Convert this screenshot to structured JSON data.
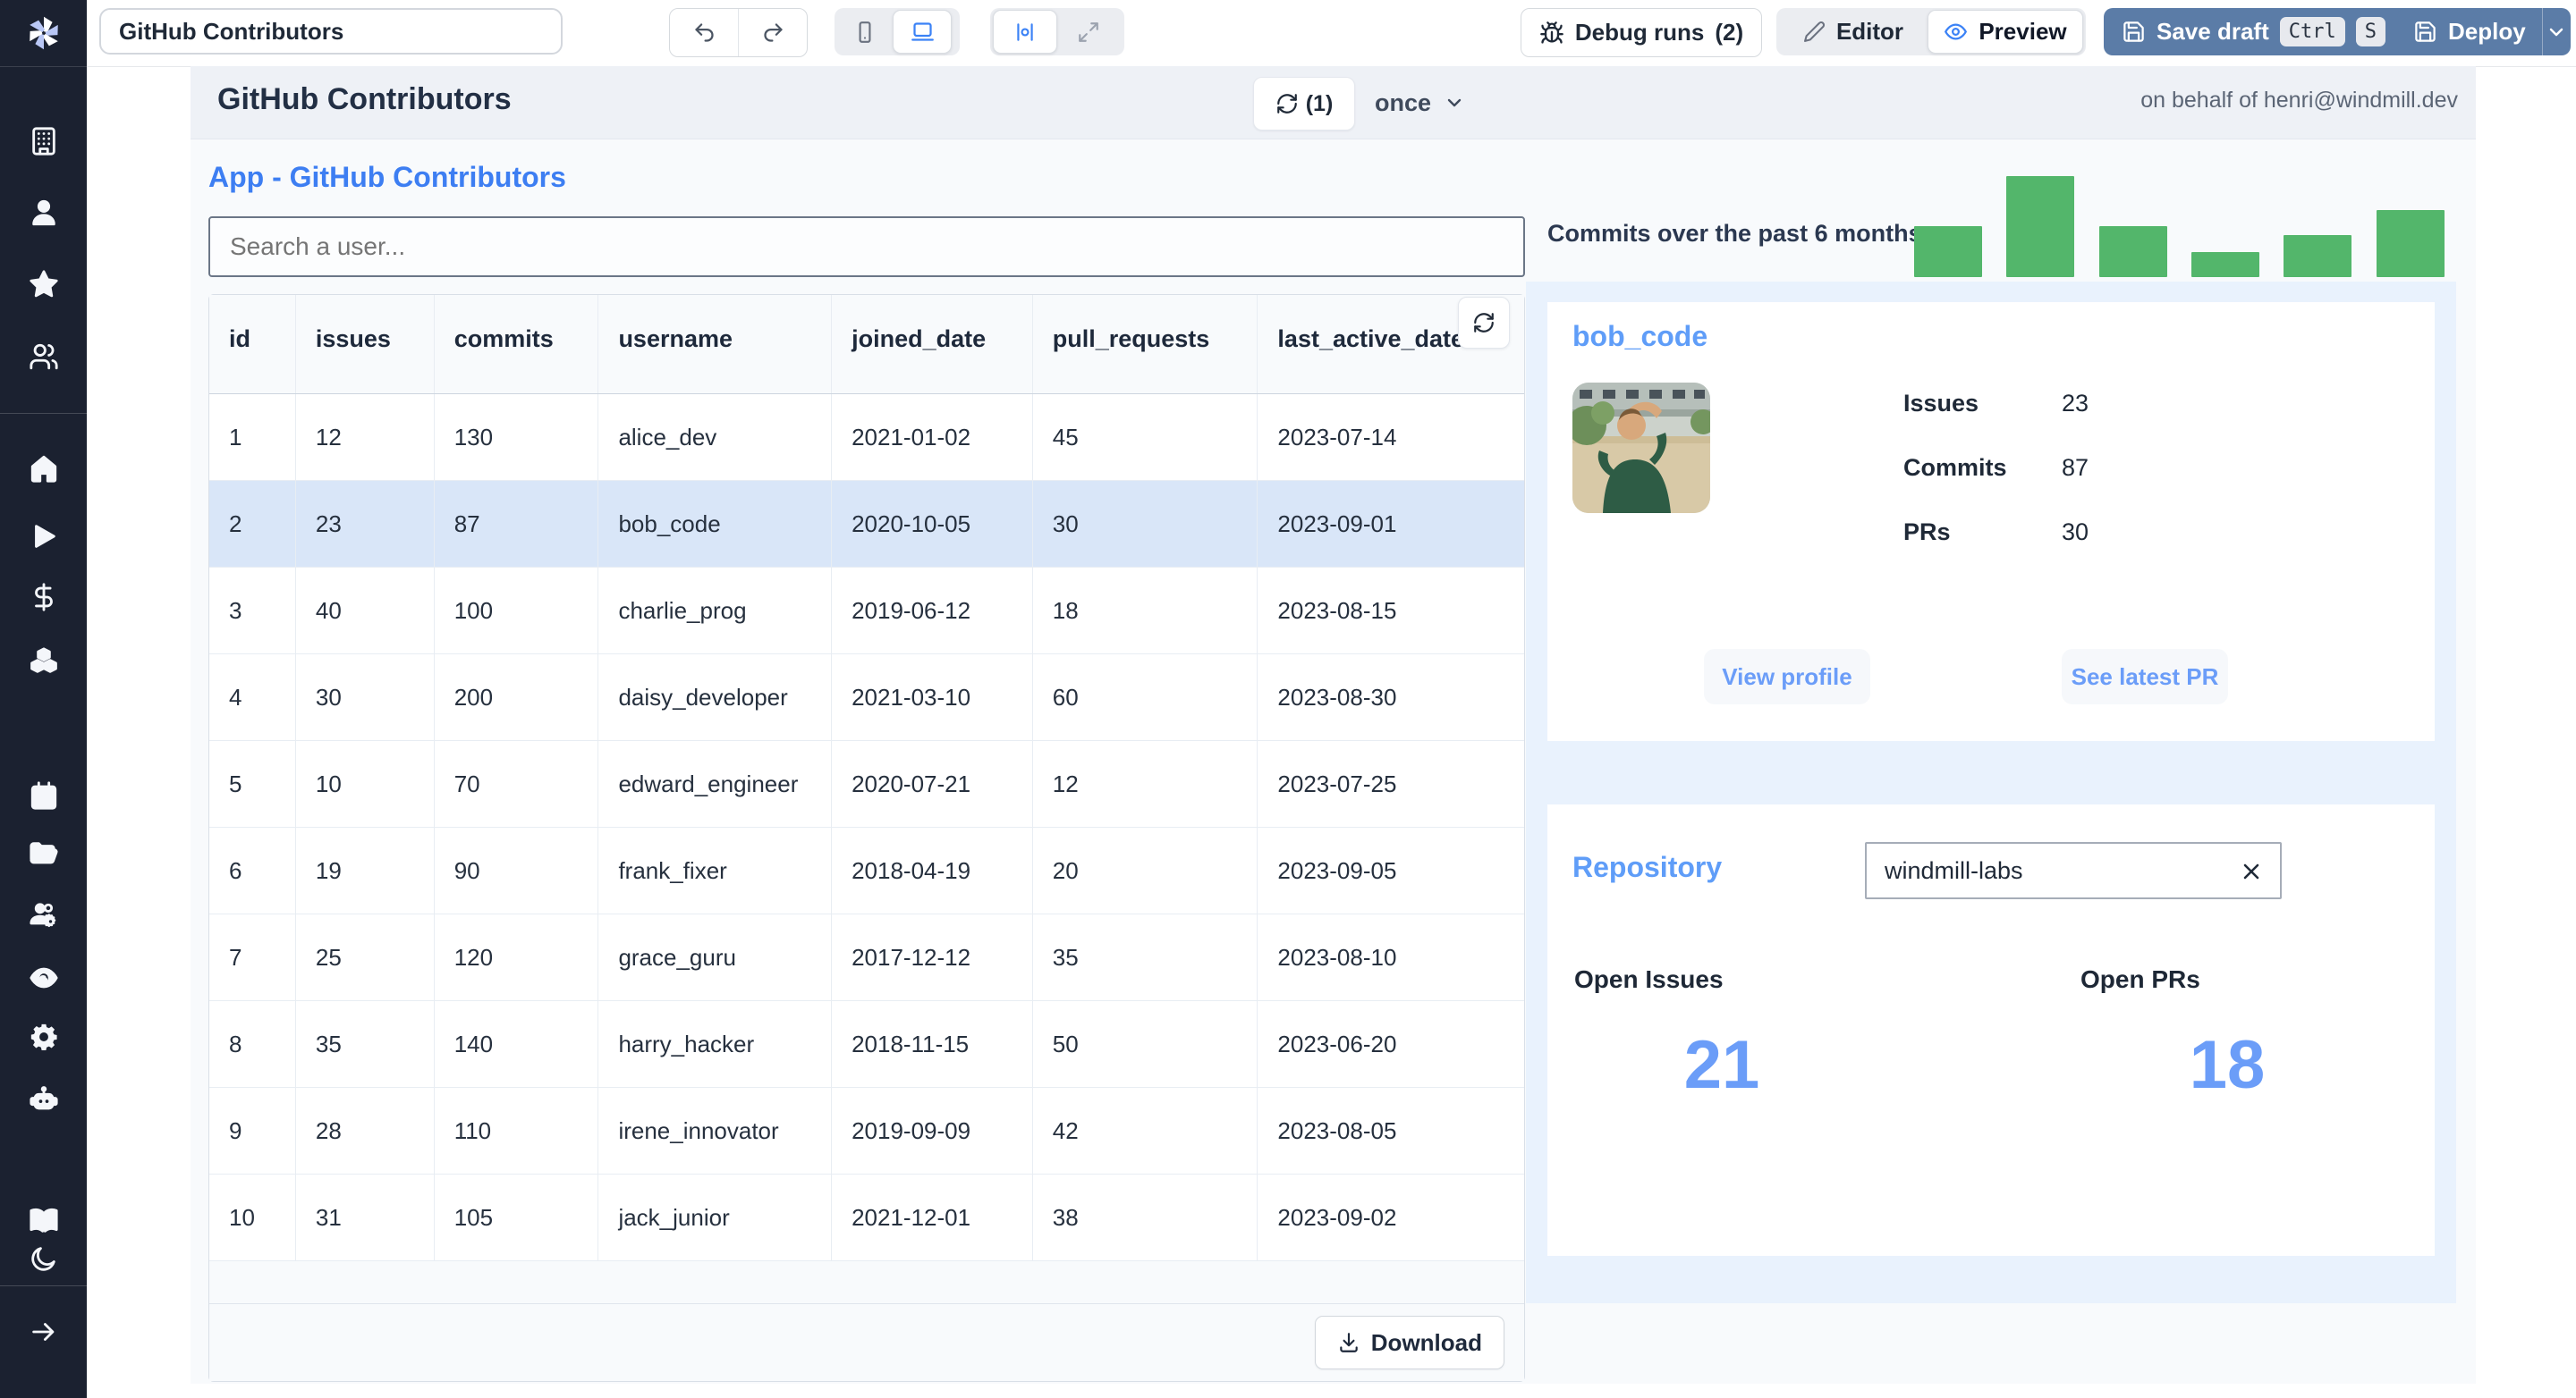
{
  "topbar": {
    "title_value": "GitHub Contributors",
    "debug_label": "Debug runs",
    "debug_count": "(2)",
    "editor_label": "Editor",
    "preview_label": "Preview",
    "save_draft_label": "Save draft",
    "kbd": [
      "Ctrl",
      "S"
    ],
    "deploy_label": "Deploy"
  },
  "header": {
    "title": "GitHub Contributors",
    "refresh_count": "(1)",
    "schedule": "once",
    "on_behalf": "on behalf of henri@windmill.dev"
  },
  "main": {
    "app_heading": "App - GitHub Contributors",
    "search_placeholder": "Search a user...",
    "table": {
      "columns": [
        "id",
        "issues",
        "commits",
        "username",
        "joined_date",
        "pull_requests",
        "last_active_date"
      ],
      "rows": [
        {
          "id": "1",
          "issues": "12",
          "commits": "130",
          "username": "alice_dev",
          "joined_date": "2021-01-02",
          "pull_requests": "45",
          "last_active_date": "2023-07-14"
        },
        {
          "id": "2",
          "issues": "23",
          "commits": "87",
          "username": "bob_code",
          "joined_date": "2020-10-05",
          "pull_requests": "30",
          "last_active_date": "2023-09-01"
        },
        {
          "id": "3",
          "issues": "40",
          "commits": "100",
          "username": "charlie_prog",
          "joined_date": "2019-06-12",
          "pull_requests": "18",
          "last_active_date": "2023-08-15"
        },
        {
          "id": "4",
          "issues": "30",
          "commits": "200",
          "username": "daisy_developer",
          "joined_date": "2021-03-10",
          "pull_requests": "60",
          "last_active_date": "2023-08-30"
        },
        {
          "id": "5",
          "issues": "10",
          "commits": "70",
          "username": "edward_engineer",
          "joined_date": "2020-07-21",
          "pull_requests": "12",
          "last_active_date": "2023-07-25"
        },
        {
          "id": "6",
          "issues": "19",
          "commits": "90",
          "username": "frank_fixer",
          "joined_date": "2018-04-19",
          "pull_requests": "20",
          "last_active_date": "2023-09-05"
        },
        {
          "id": "7",
          "issues": "25",
          "commits": "120",
          "username": "grace_guru",
          "joined_date": "2017-12-12",
          "pull_requests": "35",
          "last_active_date": "2023-08-10"
        },
        {
          "id": "8",
          "issues": "35",
          "commits": "140",
          "username": "harry_hacker",
          "joined_date": "2018-11-15",
          "pull_requests": "50",
          "last_active_date": "2023-06-20"
        },
        {
          "id": "9",
          "issues": "28",
          "commits": "110",
          "username": "irene_innovator",
          "joined_date": "2019-09-09",
          "pull_requests": "42",
          "last_active_date": "2023-08-05"
        },
        {
          "id": "10",
          "issues": "31",
          "commits": "105",
          "username": "jack_junior",
          "joined_date": "2021-12-01",
          "pull_requests": "38",
          "last_active_date": "2023-09-02"
        }
      ],
      "selected_row_index": 1,
      "download_label": "Download"
    }
  },
  "right": {
    "chart_label": "Commits over the past 6 months:",
    "user_card": {
      "username": "bob_code",
      "stats": [
        {
          "label": "Issues",
          "value": "23"
        },
        {
          "label": "Commits",
          "value": "87"
        },
        {
          "label": "PRs",
          "value": "30"
        }
      ],
      "buttons": [
        "View profile",
        "See latest PR"
      ]
    },
    "repo_card": {
      "heading": "Repository",
      "input_value": "windmill-labs",
      "open_issues_label": "Open Issues",
      "open_issues_value": "21",
      "open_prs_label": "Open PRs",
      "open_prs_value": "18"
    }
  },
  "chart_data": {
    "type": "bar",
    "title": "Commits over the past 6 months:",
    "values": [
      50,
      100,
      50,
      25,
      42,
      66
    ],
    "axes_visible": false,
    "grid": false,
    "legend": "none",
    "bar_color": "#53b66b"
  },
  "sidebar": {
    "icons": [
      "building-icon",
      "user-icon",
      "star-icon",
      "users-icon",
      "home-icon",
      "play-icon",
      "dollar-icon",
      "boxes-icon",
      "calendar-icon",
      "folder-open-icon",
      "users-gear-icon",
      "eye-icon",
      "gear-icon",
      "bot-icon",
      "book-open-icon",
      "moon-icon",
      "arrow-right-icon"
    ]
  },
  "colors": {
    "accent_blue": "#3d7ef2",
    "light_blue": "#6b9df8",
    "bar_green": "#53b66b",
    "action_blue": "#5b7ca7",
    "selected_row": "#d9e6f8",
    "sidebar_bg": "#1b2130"
  }
}
